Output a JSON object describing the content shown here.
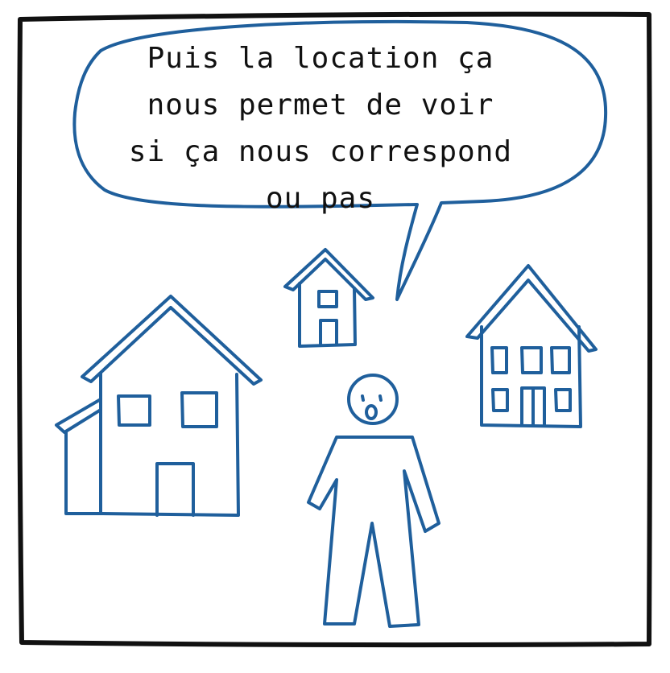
{
  "speech_bubble": {
    "text": "Puis la location ça\nnous permet de voir\nsi ça nous correspond\nou pas"
  },
  "colors": {
    "drawing_blue": "#1f5f9c",
    "frame_black": "#111111",
    "text_black": "#111111",
    "background": "#ffffff"
  }
}
